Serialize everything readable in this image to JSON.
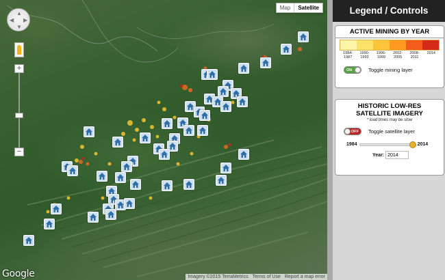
{
  "map": {
    "type_buttons": [
      "Map",
      "Satellite"
    ],
    "active_type": "Satellite",
    "zoom_in": "+",
    "zoom_out": "−",
    "logo": "Google",
    "attribution": [
      "Imagery ©2015 TerraMetrics",
      "Terms of Use",
      "Report a map error"
    ],
    "icon_names": [
      "pan-control-icon",
      "pegman-icon",
      "house-icon"
    ]
  },
  "panel": {
    "title": "Legend / Controls",
    "mining": {
      "heading": "ACTIVE MINING BY YEAR",
      "colors": [
        "#fff5a8",
        "#ffe16b",
        "#ffc43a",
        "#ff9a1f",
        "#f35c1c",
        "#d62a18"
      ],
      "year_labels": [
        "1984-\n1987",
        "1990-\n1993",
        "1996-\n1999",
        "2002-\n2005",
        "2008-\n2011",
        "2014"
      ],
      "toggle_state": "ON",
      "toggle_label": "Toggle mining layer"
    },
    "imagery": {
      "heading": "HISTORIC LOW-RES SATELLITE IMAGERY",
      "note": "* load times may be slow",
      "toggle_state": "OFF",
      "toggle_label": "Toggle satellite layer",
      "slider_min": "1984",
      "slider_max": "2014",
      "slider_fraction": 1.0,
      "year_label": "Year:",
      "year_value": "2014"
    }
  }
}
